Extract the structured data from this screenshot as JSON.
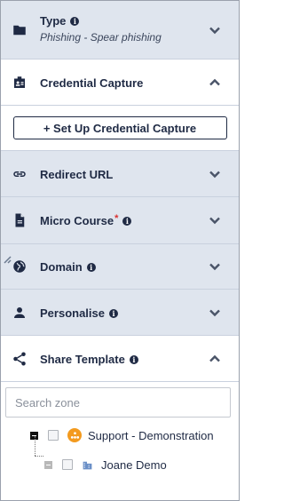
{
  "sections": {
    "type": {
      "title": "Type",
      "subtitle": "Phishing - Spear phishing"
    },
    "credential_capture": {
      "title": "Credential Capture",
      "button_label": "+ Set Up Credential Capture"
    },
    "redirect_url": {
      "title": "Redirect URL"
    },
    "micro_course": {
      "title": "Micro Course",
      "required_mark": "*"
    },
    "domain": {
      "title": "Domain"
    },
    "personalise": {
      "title": "Personalise"
    },
    "share_template": {
      "title": "Share Template",
      "search_placeholder": "Search zone",
      "tree": [
        {
          "label": "Support - Demonstration"
        },
        {
          "label": "Joane Demo"
        }
      ]
    }
  },
  "info_glyph": "i",
  "icons": {
    "type": "folder-icon",
    "credential_capture": "id-badge-icon",
    "redirect_url": "link-icon",
    "micro_course": "document-icon",
    "domain": "globe-icon",
    "personalise": "person-icon",
    "share_template": "share-icon"
  },
  "colors": {
    "collapsed_bg": "#dfe5ee",
    "text": "#1f2a44",
    "required": "#d93030",
    "org_icon": "#f39a1e",
    "building_icon": "#6a8fc7"
  }
}
